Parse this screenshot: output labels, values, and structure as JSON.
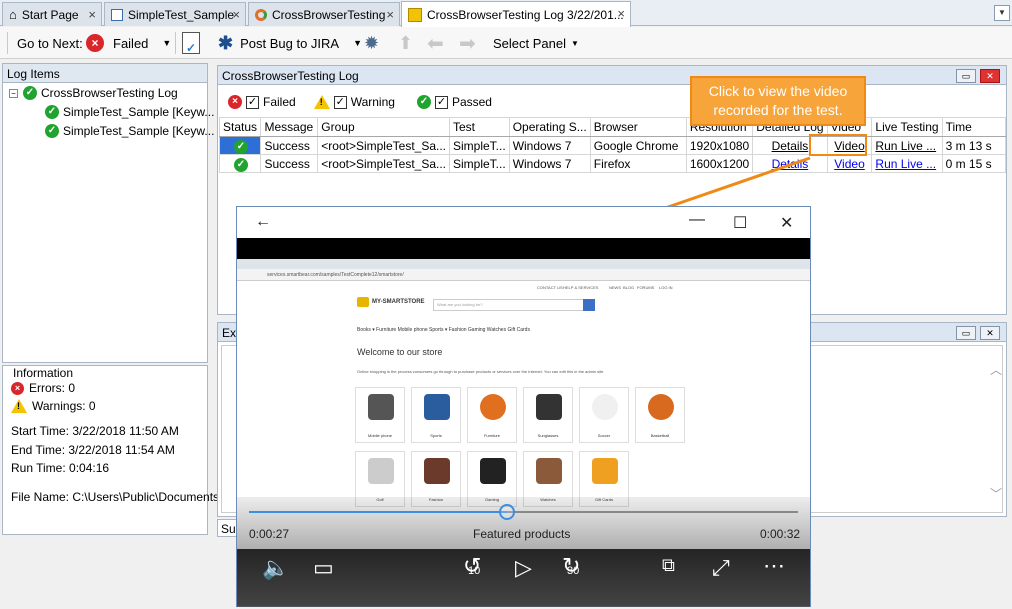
{
  "tabs": [
    {
      "label": "Start Page",
      "icon": "home-icon"
    },
    {
      "label": "SimpleTest_Sample",
      "icon": "keyword-test-icon"
    },
    {
      "label": "CrossBrowserTesting",
      "icon": "crossbrowser-icon"
    },
    {
      "label": "CrossBrowserTesting Log 3/22/201...",
      "icon": "log-icon",
      "active": true
    }
  ],
  "toolbar": {
    "go_to_next": "Go to Next:",
    "failed": "Failed",
    "post_bug": "Post Bug to JIRA",
    "select_panel": "Select Panel"
  },
  "left_panel": {
    "title": "Log Items",
    "root": "CrossBrowserTesting Log",
    "children": [
      "SimpleTest_Sample [Keyw...",
      "SimpleTest_Sample [Keyw..."
    ]
  },
  "info": {
    "title": "Information",
    "errors": "Errors: 0",
    "warnings": "Warnings: 0",
    "start_time": "Start Time: 3/22/2018 11:50 AM",
    "end_time": "End Time: 3/22/2018 11:54 AM",
    "run_time": "Run Time: 0:04:16",
    "file_name": "File Name: C:\\Users\\Public\\Documents\\"
  },
  "main_panel": {
    "title": "CrossBrowserTesting Log",
    "filters": {
      "failed": "Failed",
      "warning": "Warning",
      "passed": "Passed"
    },
    "columns": [
      "Status",
      "Message",
      "Group",
      "Test",
      "Operating S...",
      "Browser",
      "Resolution",
      "Detailed Log",
      "Video",
      "Live Testing",
      "Time"
    ],
    "rows": [
      {
        "message": "Success",
        "group": "<root>SimpleTest_Sa...",
        "test": "SimpleT...",
        "os": "Windows 7",
        "browser": "Google Chrome",
        "resolution": "1920x1080",
        "detailed": "Details",
        "video": "Video",
        "live": "Run Live ...",
        "time": "3 m 13 s"
      },
      {
        "message": "Success",
        "group": "<root>SimpleTest_Sa...",
        "test": "SimpleT...",
        "os": "Windows 7",
        "browser": "Firefox",
        "resolution": "1600x1200",
        "detailed": "Details",
        "video": "Video",
        "live": "Run Live ...",
        "time": "0 m 15 s"
      }
    ]
  },
  "ext_panel": {
    "title": "Ext",
    "tab": "Sur"
  },
  "callout": {
    "line1": "Click to view the video",
    "line2": "recorded for the test."
  },
  "video": {
    "current_time": "0:00:27",
    "total_time": "0:00:32",
    "progress": 0.47,
    "caption": "Featured products",
    "skip_back": "10",
    "skip_fwd": "30"
  },
  "webpage": {
    "url": "services.smartbear.com/samples/TestComplete12/smartstore/",
    "top_links": [
      "CONTACT US",
      "HELP & SERVICES",
      "NEWS",
      "BLOG",
      "FORUMS",
      "LOG IN"
    ],
    "logo": "MY-SMARTSTORE",
    "search_placeholder": "What are you looking for?",
    "categories": "Books ▾   Furniture   Mobile phone   Sports ▾   Fashion   Gaming   Watches   Gift Cards",
    "welcome": "Welcome to our store",
    "welcome_text": "Online shopping is the process consumers go through to purchase products or services over the Internet. You can edit this in the admin site.",
    "products": [
      "Mobile phone",
      "Sports",
      "Furniture",
      "Sunglasses",
      "Soccer",
      "Basketball",
      "Golf",
      "Fashion",
      "Gaming",
      "Watches",
      "Gift Cards"
    ],
    "product_colors": [
      "#555555",
      "#2a5d9e",
      "#e07020",
      "#333333",
      "#f0f0f0",
      "#d86a20",
      "#cccccc",
      "#6b3a2a",
      "#222222",
      "#8a5a3a",
      "#f0a020"
    ]
  }
}
